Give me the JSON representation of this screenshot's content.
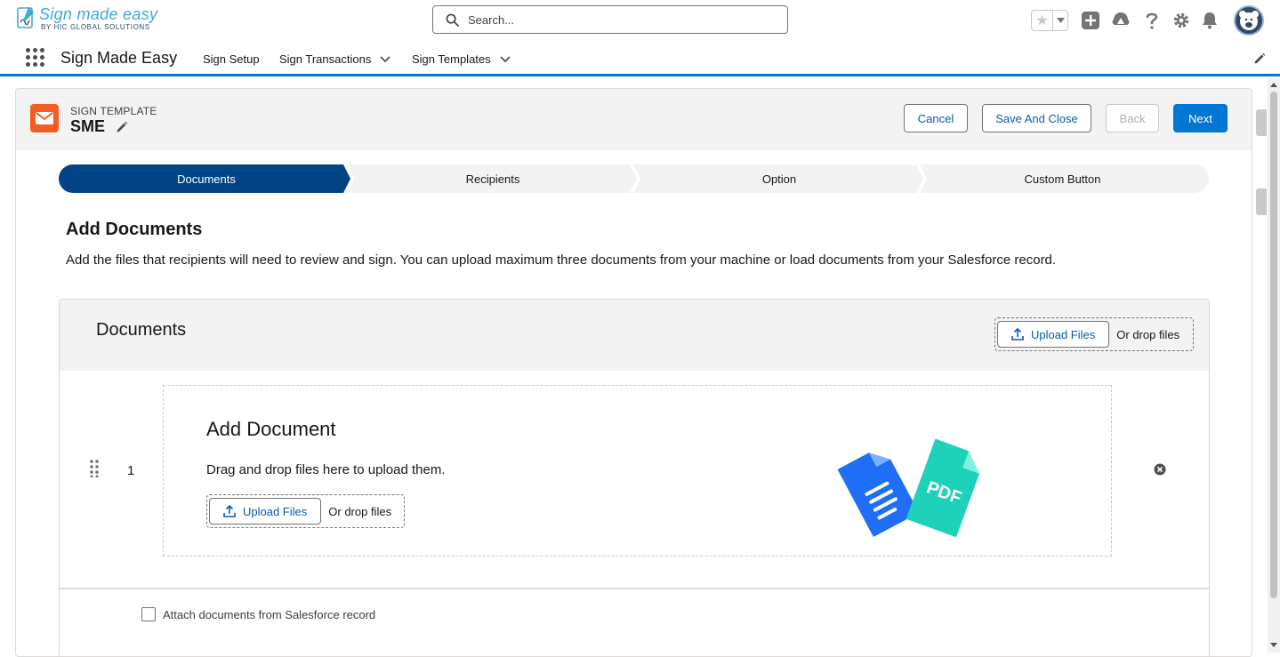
{
  "logo": {
    "main": "Sign made easy",
    "sub": "BY HIC GLOBAL SOLUTIONS"
  },
  "search": {
    "placeholder": "Search..."
  },
  "nav": {
    "app_name": "Sign Made Easy",
    "items": [
      {
        "label": "Sign Setup"
      },
      {
        "label": "Sign Transactions"
      },
      {
        "label": "Sign Templates"
      }
    ]
  },
  "record": {
    "eyebrow": "SIGN TEMPLATE",
    "title": "SME"
  },
  "actions": {
    "cancel": "Cancel",
    "save_close": "Save And Close",
    "back": "Back",
    "next": "Next"
  },
  "path": {
    "steps": [
      {
        "label": "Documents",
        "active": true
      },
      {
        "label": "Recipients",
        "active": false
      },
      {
        "label": "Option",
        "active": false
      },
      {
        "label": "Custom Button",
        "active": false
      }
    ]
  },
  "section": {
    "title": "Add Documents",
    "description": "Add the files that recipients will need to review and sign. You can upload maximum three documents from your machine or load documents from your Salesforce record."
  },
  "documents": {
    "title": "Documents",
    "upload_label": "Upload Files",
    "drop_label": "Or drop files",
    "rows": [
      {
        "number": "1",
        "title": "Add Document",
        "description": "Drag and drop files here to upload them.",
        "upload_label": "Upload Files",
        "drop_label": "Or drop files",
        "illustration_text": "PDF"
      }
    ],
    "attach_label": "Attach documents from Salesforce record",
    "attach_checked": false
  },
  "colors": {
    "brand": "#0176d3",
    "path_active": "#014486",
    "record_icon": "#f45d22"
  }
}
